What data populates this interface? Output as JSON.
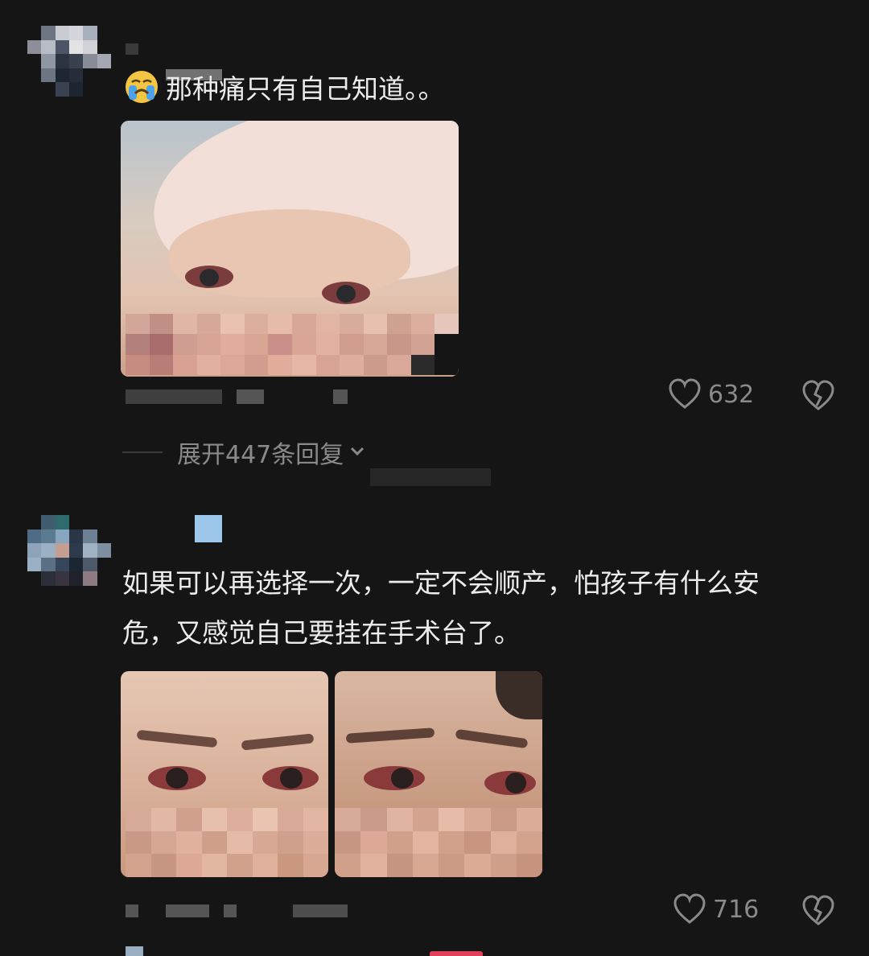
{
  "comments": [
    {
      "text": "那种痛只有自己知道。。",
      "emoji_icon": "loudly-crying-face-icon",
      "likes": "632",
      "expand_label": "展开447条回复"
    },
    {
      "text_line1": "如果可以再选择一次，一定不会顺产，怕孩子有什么安",
      "text_line2": "危，又感觉自己要挂在手术台了。",
      "likes": "716"
    }
  ],
  "colors": {
    "background": "#151515",
    "text": "#ececec",
    "muted": "#8a8a8a"
  }
}
